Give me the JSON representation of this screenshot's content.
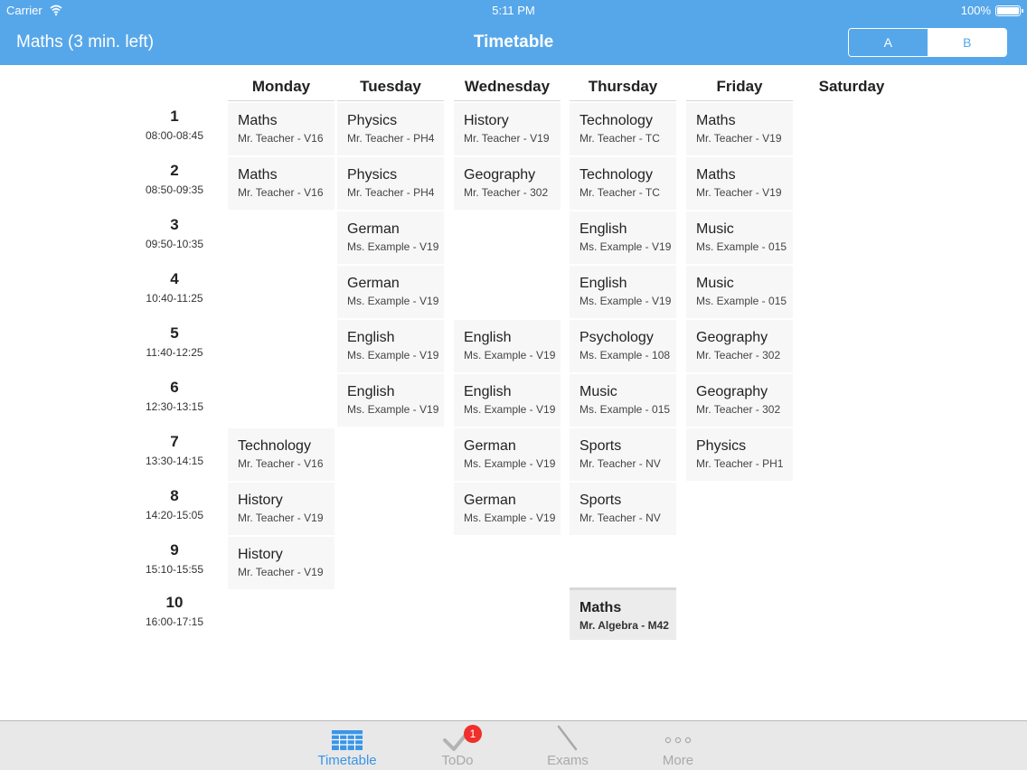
{
  "status": {
    "carrier": "Carrier",
    "time": "5:11 PM",
    "battery": "100%"
  },
  "nav": {
    "left": "Maths (3 min. left)",
    "title": "Timetable",
    "segments": [
      "A",
      "B"
    ]
  },
  "days": [
    "Monday",
    "Tuesday",
    "Wednesday",
    "Thursday",
    "Friday",
    "Saturday"
  ],
  "periods": [
    {
      "num": "1",
      "time": "08:00-08:45"
    },
    {
      "num": "2",
      "time": "08:50-09:35"
    },
    {
      "num": "3",
      "time": "09:50-10:35"
    },
    {
      "num": "4",
      "time": "10:40-11:25"
    },
    {
      "num": "5",
      "time": "11:40-12:25"
    },
    {
      "num": "6",
      "time": "12:30-13:15"
    },
    {
      "num": "7",
      "time": "13:30-14:15"
    },
    {
      "num": "8",
      "time": "14:20-15:05"
    },
    {
      "num": "9",
      "time": "15:10-15:55"
    },
    {
      "num": "10",
      "time": "16:00-17:15"
    }
  ],
  "lessons": [
    {
      "day": 0,
      "period": 0,
      "subject": "Maths",
      "info": "Mr. Teacher - V16"
    },
    {
      "day": 0,
      "period": 1,
      "subject": "Maths",
      "info": "Mr. Teacher - V16"
    },
    {
      "day": 0,
      "period": 6,
      "subject": "Technology",
      "info": "Mr. Teacher - V16"
    },
    {
      "day": 0,
      "period": 7,
      "subject": "History",
      "info": "Mr. Teacher - V19"
    },
    {
      "day": 0,
      "period": 8,
      "subject": "History",
      "info": "Mr. Teacher - V19"
    },
    {
      "day": 1,
      "period": 0,
      "subject": "Physics",
      "info": "Mr. Teacher - PH4"
    },
    {
      "day": 1,
      "period": 1,
      "subject": "Physics",
      "info": "Mr. Teacher - PH4"
    },
    {
      "day": 1,
      "period": 2,
      "subject": "German",
      "info": "Ms. Example - V19"
    },
    {
      "day": 1,
      "period": 3,
      "subject": "German",
      "info": "Ms. Example - V19"
    },
    {
      "day": 1,
      "period": 4,
      "subject": "English",
      "info": "Ms. Example - V19"
    },
    {
      "day": 1,
      "period": 5,
      "subject": "English",
      "info": "Ms. Example - V19"
    },
    {
      "day": 2,
      "period": 0,
      "subject": "History",
      "info": "Mr. Teacher - V19"
    },
    {
      "day": 2,
      "period": 1,
      "subject": "Geography",
      "info": "Mr. Teacher - 302"
    },
    {
      "day": 2,
      "period": 4,
      "subject": "English",
      "info": "Ms. Example - V19"
    },
    {
      "day": 2,
      "period": 5,
      "subject": "English",
      "info": "Ms. Example - V19"
    },
    {
      "day": 2,
      "period": 6,
      "subject": "German",
      "info": "Ms. Example - V19"
    },
    {
      "day": 2,
      "period": 7,
      "subject": "German",
      "info": "Ms. Example - V19"
    },
    {
      "day": 3,
      "period": 0,
      "subject": "Technology",
      "info": "Mr. Teacher - TC"
    },
    {
      "day": 3,
      "period": 1,
      "subject": "Technology",
      "info": "Mr. Teacher - TC"
    },
    {
      "day": 3,
      "period": 2,
      "subject": "English",
      "info": "Ms. Example - V19"
    },
    {
      "day": 3,
      "period": 3,
      "subject": "English",
      "info": "Ms. Example - V19"
    },
    {
      "day": 3,
      "period": 4,
      "subject": "Psychology",
      "info": "Ms. Example - 108"
    },
    {
      "day": 3,
      "period": 5,
      "subject": "Music",
      "info": "Ms. Example - 015"
    },
    {
      "day": 3,
      "period": 6,
      "subject": "Sports",
      "info": "Mr. Teacher - NV"
    },
    {
      "day": 3,
      "period": 7,
      "subject": "Sports",
      "info": "Mr. Teacher - NV"
    },
    {
      "day": 3,
      "period": 9,
      "subject": "Maths",
      "info": "Mr. Algebra - M42",
      "special": true
    },
    {
      "day": 4,
      "period": 0,
      "subject": "Maths",
      "info": "Mr. Teacher - V19"
    },
    {
      "day": 4,
      "period": 1,
      "subject": "Maths",
      "info": "Mr. Teacher - V19"
    },
    {
      "day": 4,
      "period": 2,
      "subject": "Music",
      "info": "Ms. Example - 015"
    },
    {
      "day": 4,
      "period": 3,
      "subject": "Music",
      "info": "Ms. Example - 015"
    },
    {
      "day": 4,
      "period": 4,
      "subject": "Geography",
      "info": "Mr. Teacher - 302"
    },
    {
      "day": 4,
      "period": 5,
      "subject": "Geography",
      "info": "Mr. Teacher - 302"
    },
    {
      "day": 4,
      "period": 6,
      "subject": "Physics",
      "info": "Mr. Teacher - PH1"
    }
  ],
  "tabs": [
    {
      "label": "Timetable",
      "icon": "calendar-grid-icon",
      "active": true
    },
    {
      "label": "ToDo",
      "icon": "checkmark-icon",
      "badge": "1"
    },
    {
      "label": "Exams",
      "icon": "pencil-icon"
    },
    {
      "label": "More",
      "icon": "more-dots-icon"
    }
  ]
}
